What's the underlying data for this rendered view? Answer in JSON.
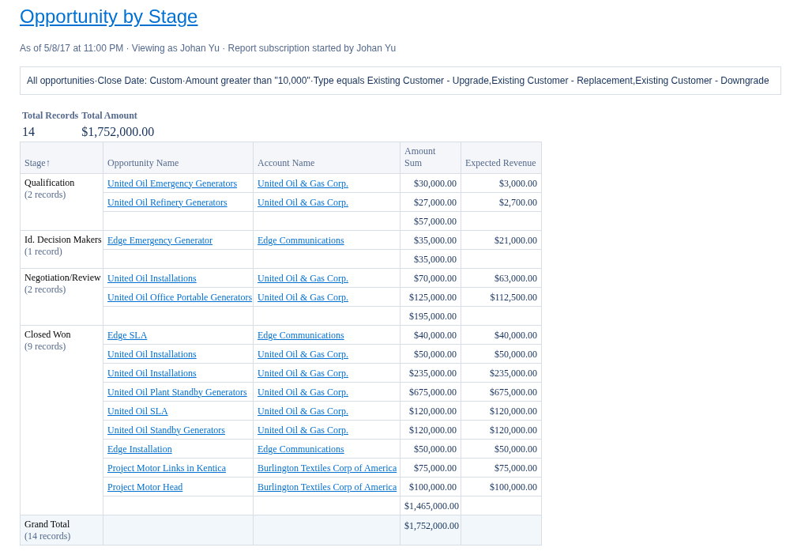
{
  "title": "Opportunity by Stage",
  "subtitle": "As of 5/8/17 at 11:00 PM · Viewing as Johan Yu · Report subscription started by Johan Yu",
  "filters": "All opportunities·Close Date: Custom·Amount greater than \"10,000\"·Type equals Existing Customer - Upgrade,Existing Customer - Replacement,Existing Customer - Downgrade",
  "summary": [
    {
      "label": "Total Records",
      "value": "14"
    },
    {
      "label": "Total Amount",
      "value": "$1,752,000.00"
    }
  ],
  "table": {
    "columns": [
      "Stage↑",
      "Opportunity Name",
      "Account Name",
      "Amount Sum",
      "Expected Revenue"
    ],
    "groups": [
      {
        "stage": "Qualification",
        "count": "(2 records)",
        "subtotal": "$57,000.00",
        "rows": [
          {
            "opportunity": "United Oil Emergency Generators",
            "account": "United Oil & Gas Corp.",
            "amount": "$30,000.00",
            "expected": "$3,000.00"
          },
          {
            "opportunity": "United Oil Refinery Generators",
            "account": "United Oil & Gas Corp.",
            "amount": "$27,000.00",
            "expected": "$2,700.00"
          }
        ]
      },
      {
        "stage": "Id. Decision Makers",
        "count": "(1 record)",
        "subtotal": "$35,000.00",
        "rows": [
          {
            "opportunity": "Edge Emergency Generator",
            "account": "Edge Communications",
            "amount": "$35,000.00",
            "expected": "$21,000.00"
          }
        ]
      },
      {
        "stage": "Negotiation/Review",
        "count": "(2 records)",
        "subtotal": "$195,000.00",
        "rows": [
          {
            "opportunity": "United Oil Installations",
            "account": "United Oil & Gas Corp.",
            "amount": "$70,000.00",
            "expected": "$63,000.00"
          },
          {
            "opportunity": "United Oil Office Portable Generators",
            "account": "United Oil & Gas Corp.",
            "amount": "$125,000.00",
            "expected": "$112,500.00"
          }
        ]
      },
      {
        "stage": "Closed Won",
        "count": "(9 records)",
        "subtotal": "$1,465,000.00",
        "rows": [
          {
            "opportunity": "Edge SLA",
            "account": "Edge Communications",
            "amount": "$40,000.00",
            "expected": "$40,000.00"
          },
          {
            "opportunity": "United Oil Installations",
            "account": "United Oil & Gas Corp.",
            "amount": "$50,000.00",
            "expected": "$50,000.00"
          },
          {
            "opportunity": "United Oil Installations",
            "account": "United Oil & Gas Corp.",
            "amount": "$235,000.00",
            "expected": "$235,000.00"
          },
          {
            "opportunity": "United Oil Plant Standby Generators",
            "account": "United Oil & Gas Corp.",
            "amount": "$675,000.00",
            "expected": "$675,000.00"
          },
          {
            "opportunity": "United Oil SLA",
            "account": "United Oil & Gas Corp.",
            "amount": "$120,000.00",
            "expected": "$120,000.00"
          },
          {
            "opportunity": "United Oil Standby Generators",
            "account": "United Oil & Gas Corp.",
            "amount": "$120,000.00",
            "expected": "$120,000.00"
          },
          {
            "opportunity": "Edge Installation",
            "account": "Edge Communications",
            "amount": "$50,000.00",
            "expected": "$50,000.00"
          },
          {
            "opportunity": "Project Motor Links in Kentica",
            "account": "Burlington Textiles Corp of America",
            "amount": "$75,000.00",
            "expected": "$75,000.00"
          },
          {
            "opportunity": "Project Motor Head",
            "account": "Burlington Textiles Corp of America",
            "amount": "$100,000.00",
            "expected": "$100,000.00"
          }
        ]
      }
    ],
    "grand_total": {
      "label": "Grand Total",
      "count": "(14 records)",
      "amount": "$1,752,000.00"
    }
  }
}
